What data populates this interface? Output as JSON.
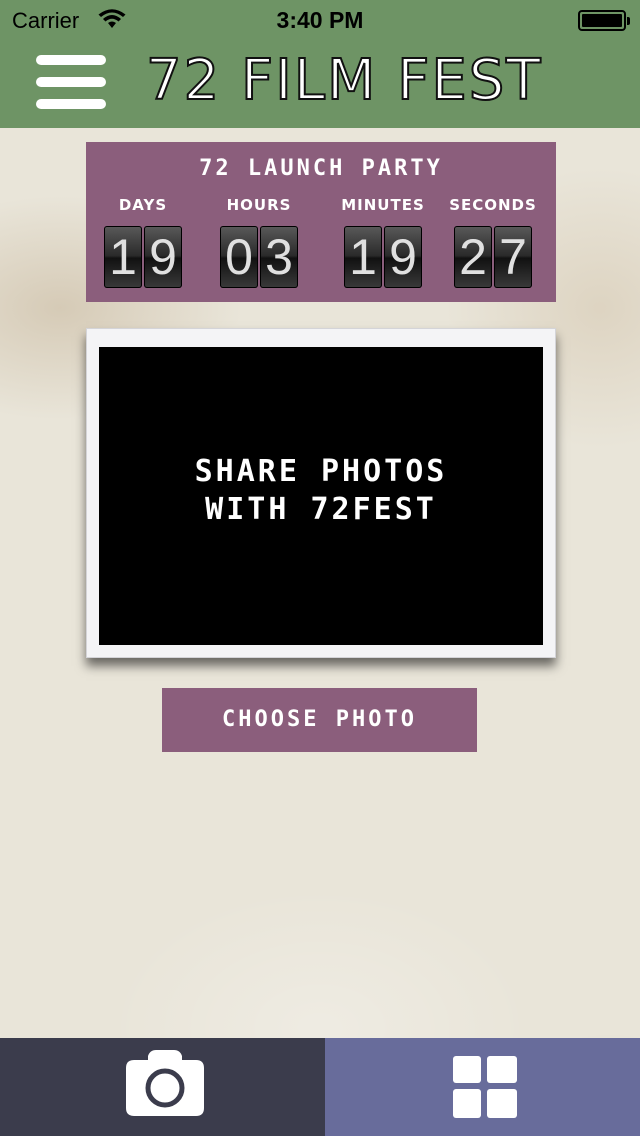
{
  "status_bar": {
    "carrier": "Carrier",
    "time": "3:40 PM",
    "wifi_icon": "wifi-icon",
    "battery_icon": "battery-icon"
  },
  "header": {
    "title": "72 FILM FEST",
    "menu_icon": "hamburger-menu-icon",
    "background": "#6e9465"
  },
  "countdown": {
    "title": "72 LAUNCH PARTY",
    "units": [
      {
        "label": "DAYS",
        "value": "19"
      },
      {
        "label": "HOURS",
        "value": "03"
      },
      {
        "label": "MINUTES",
        "value": "19"
      },
      {
        "label": "SECONDS",
        "value": "27"
      }
    ],
    "background": "#8b5e7c"
  },
  "photo_frame": {
    "line1": "SHARE PHOTOS",
    "line2": "WITH 72FEST"
  },
  "choose_button": {
    "label": "CHOOSE PHOTO",
    "background": "#8b5e7c"
  },
  "tab_bar": {
    "tabs": [
      {
        "icon": "camera-icon",
        "background": "#3b3c4c"
      },
      {
        "icon": "grid-icon",
        "background": "#686c9b"
      }
    ]
  }
}
